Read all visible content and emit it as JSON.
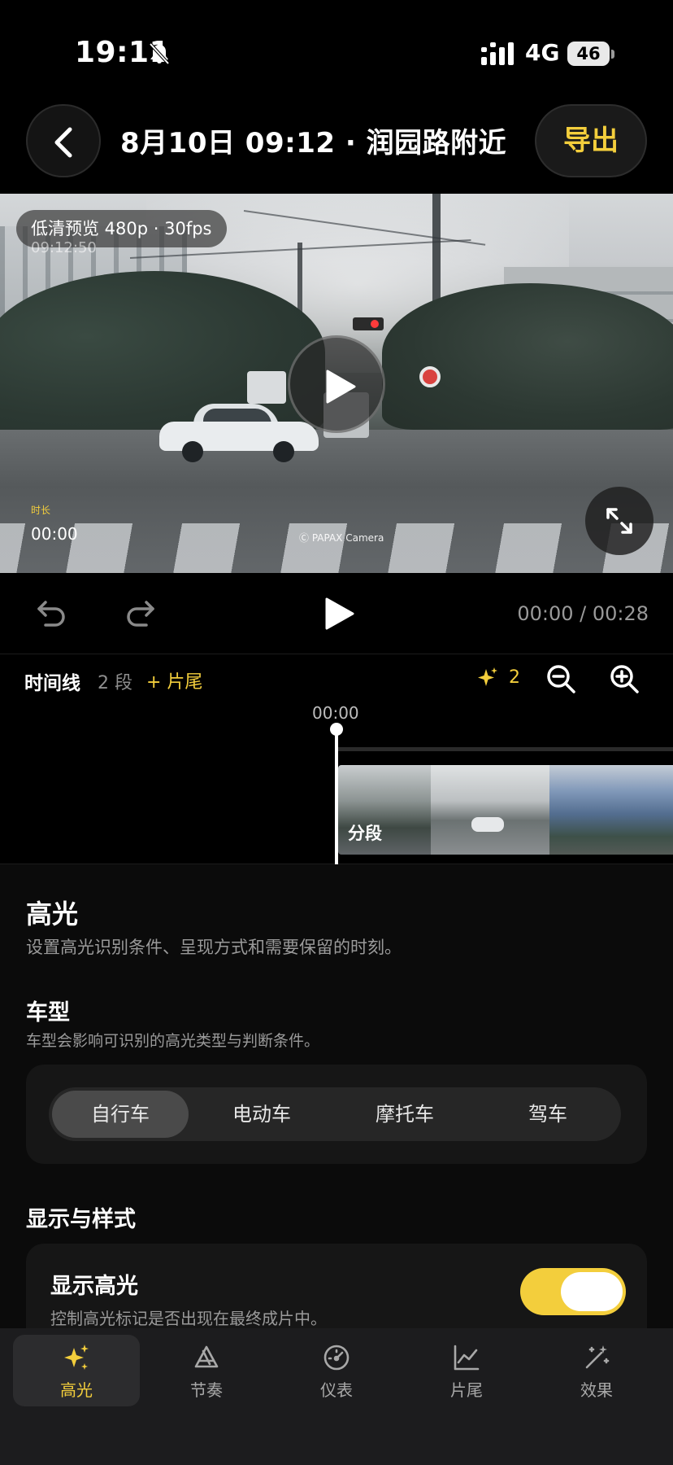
{
  "status_bar": {
    "time": "19:11",
    "network": "4G",
    "battery": "46"
  },
  "header": {
    "title": "8月10日 09:12 · 润园路附近",
    "export_label": "导出"
  },
  "video": {
    "preview_badge": "低清预览 480p · 30fps",
    "timestamp_overlay": "09:12:50",
    "duration_label": "时长",
    "duration_value": "00:00",
    "watermark": "Ⓒ PAPAX Camera"
  },
  "controls": {
    "playback_time": "00:00 / 00:28"
  },
  "timeline": {
    "title": "时间线",
    "segment_count": "2 段",
    "add_outro": "+ 片尾",
    "highlight_count": "2",
    "playhead_time": "00:00",
    "clip_label": "分段"
  },
  "panel": {
    "title": "高光",
    "subtitle": "设置高光识别条件、呈现方式和需要保留的时刻。",
    "vehicle_section": {
      "title": "车型",
      "subtitle": "车型会影响可识别的高光类型与判断条件。",
      "options": [
        "自行车",
        "电动车",
        "摩托车",
        "驾车"
      ],
      "selected": "自行车"
    },
    "display_section": {
      "title": "显示与样式",
      "toggle_title": "显示高光",
      "toggle_subtitle": "控制高光标记是否出现在最终成片中。",
      "toggle_on": true
    }
  },
  "bottom_nav": {
    "items": [
      {
        "label": "高光",
        "icon": "sparkles-icon",
        "active": true
      },
      {
        "label": "节奏",
        "icon": "rhythm-icon",
        "active": false
      },
      {
        "label": "仪表",
        "icon": "gauge-icon",
        "active": false
      },
      {
        "label": "片尾",
        "icon": "chart-icon",
        "active": false
      },
      {
        "label": "效果",
        "icon": "magic-wand-icon",
        "active": false
      }
    ]
  },
  "colors": {
    "accent": "#f3ce3c",
    "background": "#000000",
    "card": "#161616"
  }
}
